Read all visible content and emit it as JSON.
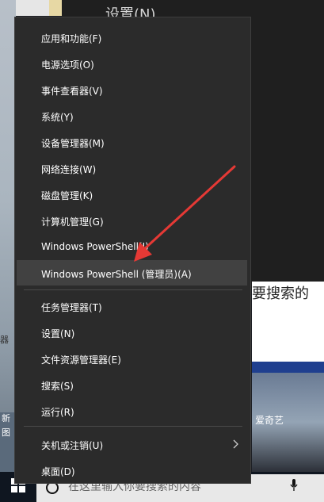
{
  "background": {
    "settings_title": "设置(N)",
    "white_panel_text": "要搜索的",
    "iqiyi_label": "爱奇艺",
    "left_text_1": "新",
    "left_text_2": "图",
    "side_text": "器"
  },
  "menu": {
    "items": [
      {
        "label": "应用和功能(F)"
      },
      {
        "label": "电源选项(O)"
      },
      {
        "label": "事件查看器(V)"
      },
      {
        "label": "系统(Y)"
      },
      {
        "label": "设备管理器(M)"
      },
      {
        "label": "网络连接(W)"
      },
      {
        "label": "磁盘管理(K)"
      },
      {
        "label": "计算机管理(G)"
      },
      {
        "label": "Windows PowerShell(I)"
      },
      {
        "label": "Windows PowerShell (管理员)(A)"
      },
      {
        "label": "任务管理器(T)"
      },
      {
        "label": "设置(N)"
      },
      {
        "label": "文件资源管理器(E)"
      },
      {
        "label": "搜索(S)"
      },
      {
        "label": "运行(R)"
      },
      {
        "label": "关机或注销(U)"
      },
      {
        "label": "桌面(D)"
      }
    ],
    "highlighted_index": 9
  },
  "taskbar": {
    "search_placeholder": "在这里输入你要搜索的内容"
  },
  "colors": {
    "menu_bg": "#2b2b2b",
    "menu_highlight": "#414141",
    "arrow": "#e53935"
  }
}
